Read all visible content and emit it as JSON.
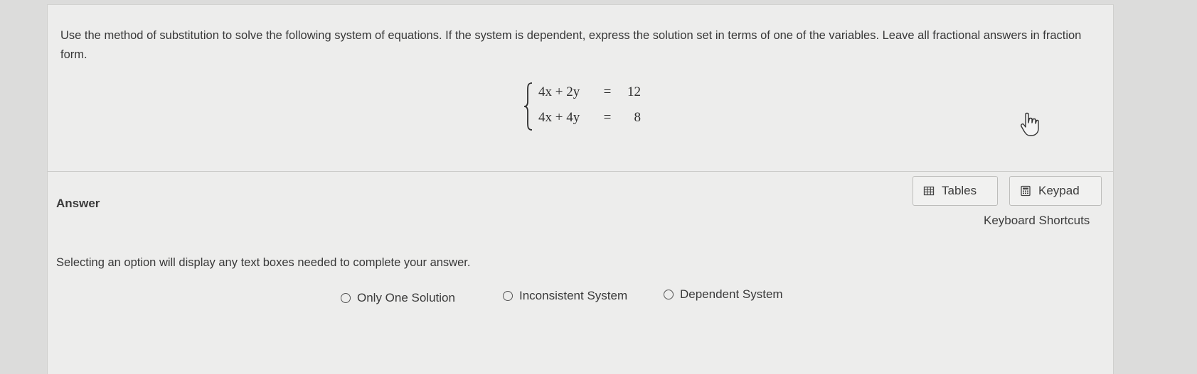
{
  "question": {
    "text": "Use the method of substitution to solve the following system of equations. If the system is dependent, express the solution set in terms of one of the variables. Leave all fractional answers in fraction form.",
    "system": [
      {
        "lhs": "4x + 2y",
        "sign": "=",
        "rhs": "12"
      },
      {
        "lhs": "4x + 4y",
        "sign": "=",
        "rhs": "8"
      }
    ]
  },
  "answer": {
    "label": "Answer",
    "tools": {
      "tables_label": "Tables",
      "keypad_label": "Keypad",
      "shortcuts_label": "Keyboard Shortcuts"
    },
    "instruction": "Selecting an option will display any text boxes needed to complete your answer.",
    "options": [
      {
        "label": "Only One Solution",
        "selected": false
      },
      {
        "label": "Inconsistent System",
        "selected": false
      },
      {
        "label": "Dependent System",
        "selected": false
      }
    ]
  },
  "icons": {
    "tables": "table-icon",
    "keypad": "calculator-icon",
    "cursor": "hand-pointer-icon"
  }
}
